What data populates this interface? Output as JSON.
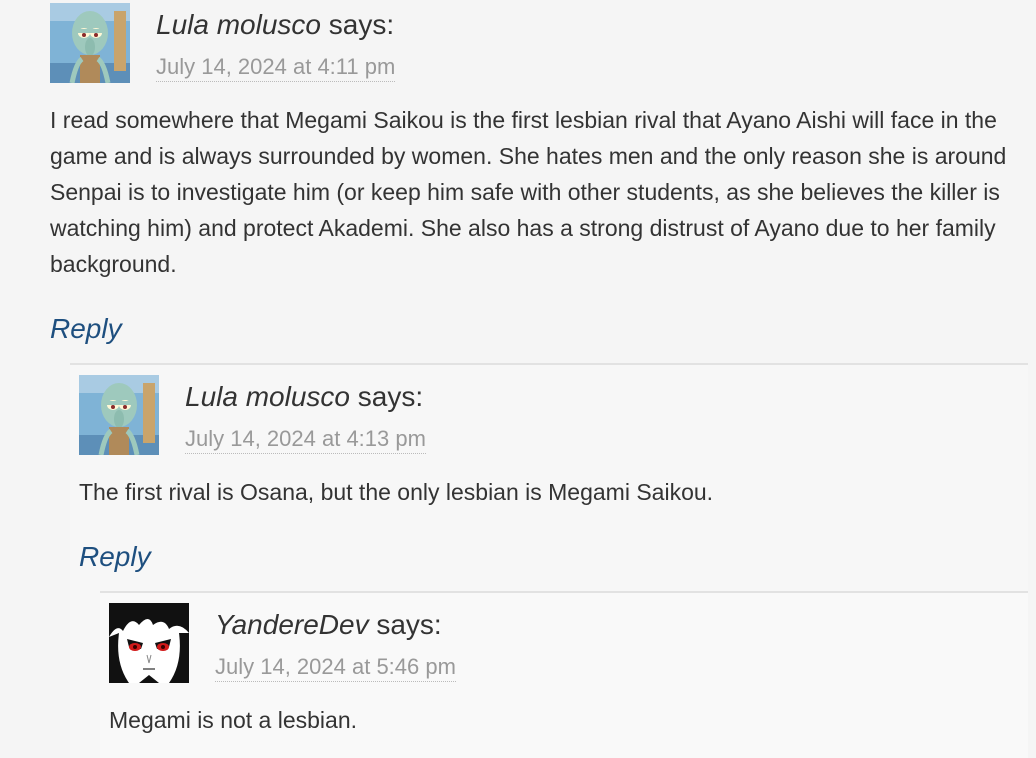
{
  "comments": [
    {
      "author": "Lula molusco",
      "says": "says:",
      "date": "July 14, 2024 at 4:11 pm",
      "text": "I read somewhere that Megami Saikou is the first lesbian rival that Ayano Aishi will face in the game and is always surrounded by women. She hates men and the only reason she is around Senpai is to investigate him (or keep him safe with other students, as she believes the killer is watching him) and protect Akademi. She also has a strong distrust of Ayano due to her family background.",
      "reply": "Reply",
      "avatar_icon": "squidward-avatar-icon"
    },
    {
      "author": "Lula molusco",
      "says": "says:",
      "date": "July 14, 2024 at 4:13 pm",
      "text": "The first rival is Osana, but the only lesbian is Megami Saikou.",
      "reply": "Reply",
      "avatar_icon": "squidward-avatar-icon"
    },
    {
      "author": "YandereDev",
      "says": "says:",
      "date": "July 14, 2024 at 5:46 pm",
      "text": "Megami is not a lesbian.",
      "avatar_icon": "anime-boy-avatar-icon"
    }
  ],
  "colors": {
    "background": "#f5f5f5",
    "text": "#333333",
    "date": "#999999",
    "reply_link": "#1e4f7f"
  }
}
